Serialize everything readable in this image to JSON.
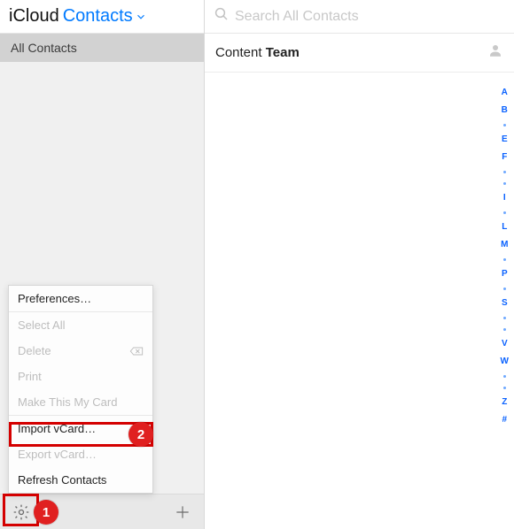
{
  "header": {
    "brand": "iCloud",
    "section": "Contacts"
  },
  "sidebar": {
    "groups_label": "All Contacts"
  },
  "search": {
    "placeholder": "Search All Contacts"
  },
  "contact": {
    "first": "Content",
    "last": "Team"
  },
  "index": [
    "A",
    "B",
    "·",
    "E",
    "F",
    "·",
    "·",
    "I",
    "·",
    "L",
    "M",
    "·",
    "P",
    "·",
    "S",
    "·",
    "·",
    "V",
    "W",
    "·",
    "·",
    "Z",
    "#"
  ],
  "menu": {
    "preferences": "Preferences…",
    "select_all": "Select All",
    "delete": "Delete",
    "print": "Print",
    "make_my_card": "Make This My Card",
    "import_vcard": "Import vCard…",
    "export_vcard": "Export vCard…",
    "refresh": "Refresh Contacts"
  },
  "annotations": {
    "badge1": "1",
    "badge2": "2"
  }
}
